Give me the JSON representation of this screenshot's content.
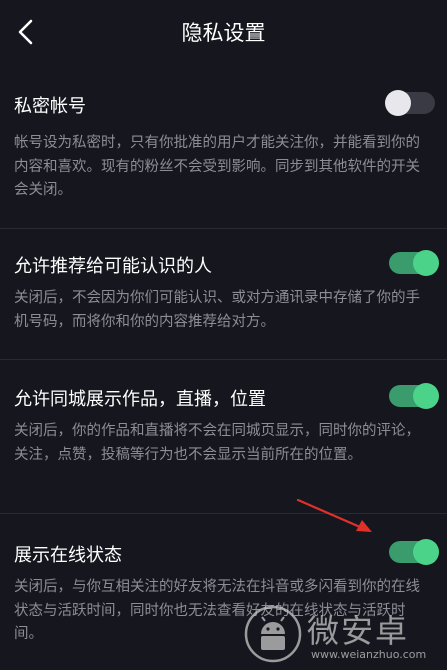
{
  "header": {
    "back_icon": "chevron-left-icon",
    "title": "隐私设置"
  },
  "settings": [
    {
      "title": "私密帐号",
      "description": "帐号设为私密时，只有你批准的用户才能关注你，并能看到你的内容和喜欢。现有的粉丝不会受到影响。同步到其他软件的开关会关闭。",
      "enabled": false
    },
    {
      "title": "允许推荐给可能认识的人",
      "description": "关闭后，不会因为你们可能认识、或对方通讯录中存储了你的手机号码，而将你和你的内容推荐给对方。",
      "enabled": true
    },
    {
      "title": "允许同城展示作品，直播，位置",
      "description": "关闭后，你的作品和直播将不会在同城页显示，同时你的评论，关注，点赞，投稿等行为也不会显示当前所在的位置。",
      "enabled": true
    },
    {
      "title": "展示在线状态",
      "description": "关闭后，与你互相关注的好友将无法在抖音或多闪看到你的在线状态与活跃时间，同时你也无法查看好友的在线状态与活跃时间。",
      "enabled": true
    }
  ],
  "watermark": {
    "text": "微安卓",
    "url": "www.weianzhuo.com",
    "icon": "android-logo-icon"
  },
  "colors": {
    "background": "#16161e",
    "toggle_on": "#4cd38a",
    "toggle_off_knob": "#e8e8ec",
    "description_text": "#8d8d96",
    "annotation_arrow": "#e0302a"
  }
}
